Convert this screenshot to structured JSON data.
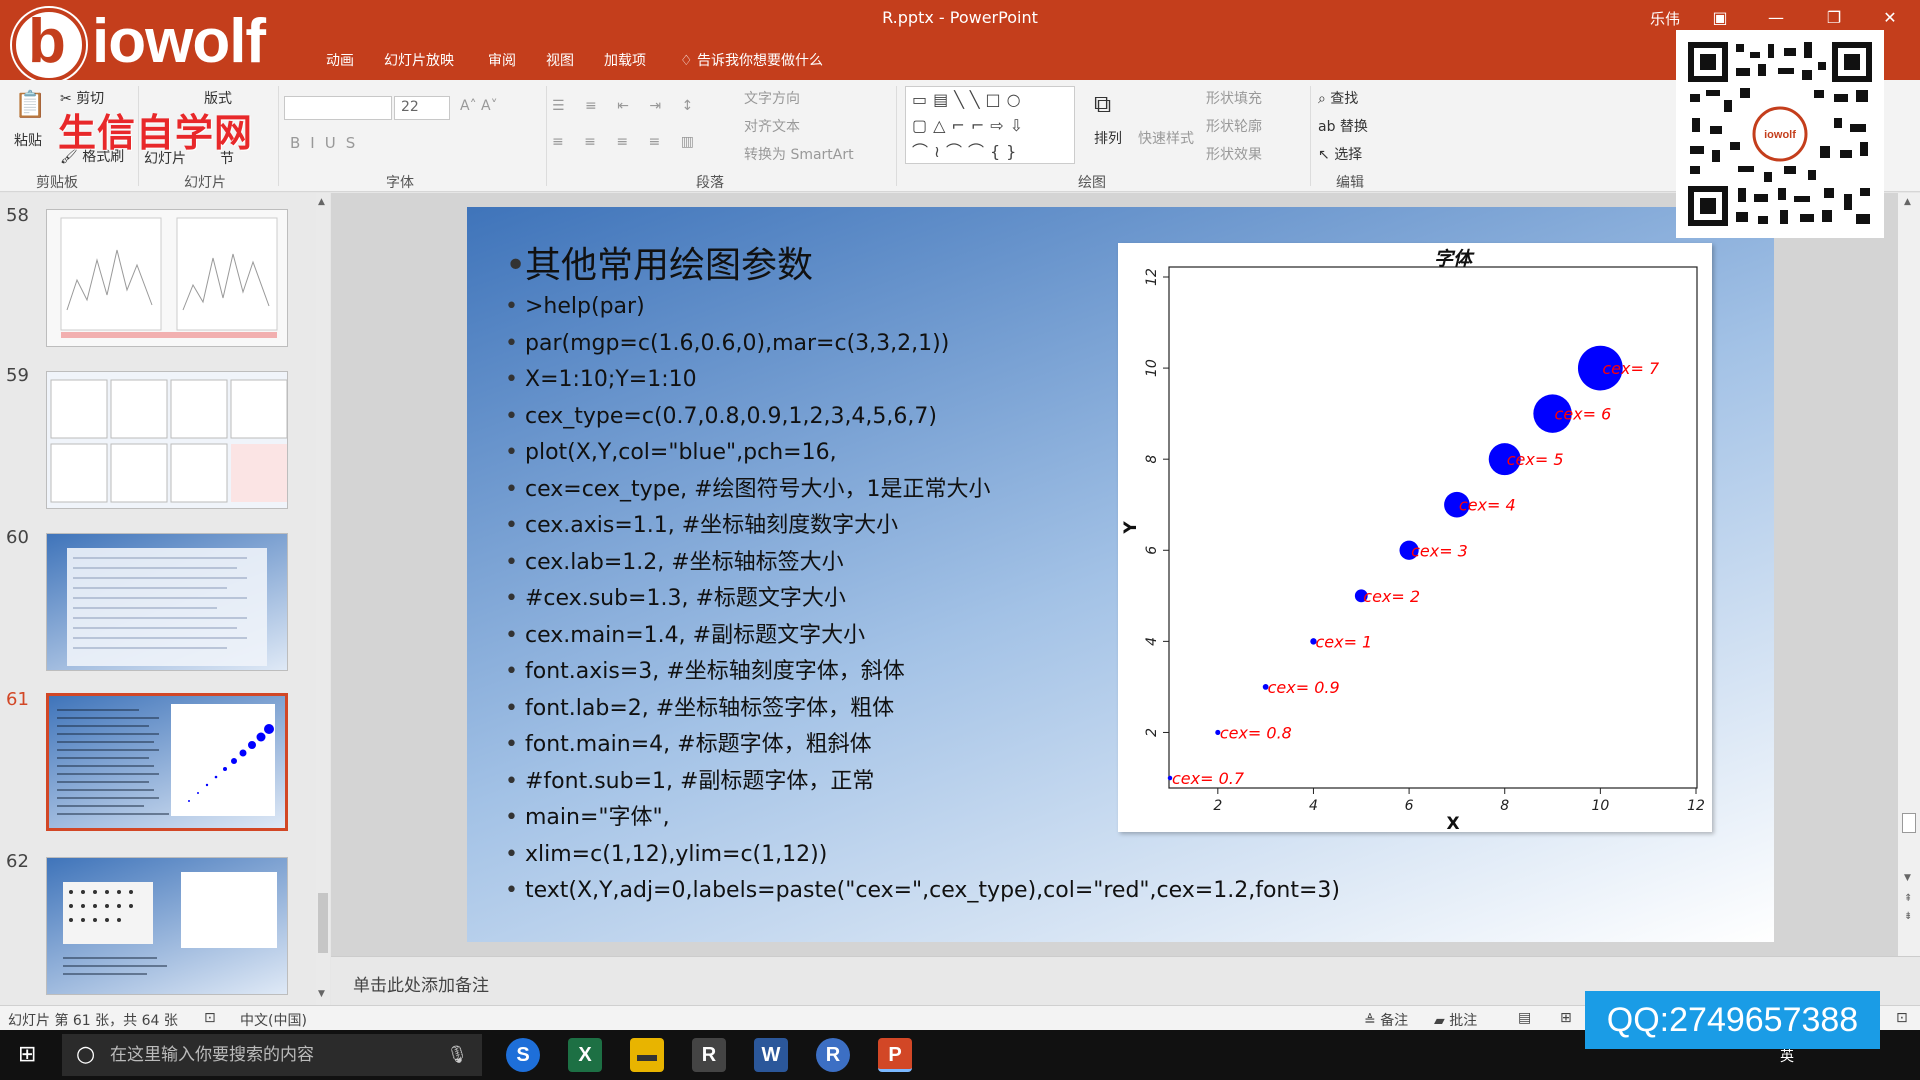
{
  "window": {
    "doc_title": "R.pptx - PowerPoint",
    "user": "乐伟",
    "logo_word": "iowolf",
    "logo_letter": "b"
  },
  "ribbon_tabs": [
    "动画",
    "幻灯片放映",
    "审阅",
    "视图",
    "加载项"
  ],
  "tell_me": "告诉我你想要做什么",
  "ribbon": {
    "site_text": "生信自学网",
    "clipboard": {
      "cut": "剪切",
      "paste": "粘贴",
      "format_painter": "格式刷",
      "group": "剪贴板"
    },
    "slides": {
      "layout": "版式",
      "section": "节",
      "slides_label": "幻灯片",
      "group": "幻灯片"
    },
    "font": {
      "size": "22",
      "group": "字体"
    },
    "paragraph": {
      "text_direction": "文字方向",
      "align_text": "对齐文本",
      "smartart": "转换为 SmartArt",
      "group": "段落"
    },
    "drawing": {
      "arrange": "排列",
      "quick_styles": "快速样式",
      "fill": "形状填充",
      "outline": "形状轮廓",
      "effects": "形状效果",
      "group": "绘图"
    },
    "editing": {
      "find": "查找",
      "replace": "替换",
      "select": "选择",
      "group": "编辑"
    }
  },
  "thumbnails": [
    {
      "num": "58"
    },
    {
      "num": "59"
    },
    {
      "num": "60"
    },
    {
      "num": "61"
    },
    {
      "num": "62"
    }
  ],
  "slide": {
    "heading": "其他常用绘图参数",
    "bullets": [
      ">help(par)",
      "par(mgp=c(1.6,0.6,0),mar=c(3,3,2,1))",
      "X=1:10;Y=1:10",
      "cex_type=c(0.7,0.8,0.9,1,2,3,4,5,6,7)",
      "plot(X,Y,col=\"blue\",pch=16,",
      "cex=cex_type,  #绘图符号大小，1是正常大小",
      "cex.axis=1.1,  #坐标轴刻度数字大小",
      "cex.lab=1.2,  #坐标轴标签大小",
      "#cex.sub=1.3,  #标题文字大小",
      "cex.main=1.4,  #副标题文字大小",
      "font.axis=3,  #坐标轴刻度字体，斜体",
      "font.lab=2,   #坐标轴标签字体，粗体",
      "font.main=4,  #标题字体，粗斜体",
      "#font.sub=1,  #副标题字体，正常",
      "main=\"字体\",",
      "xlim=c(1,12),ylim=c(1,12))",
      "text(X,Y,adj=0,labels=paste(\"cex=\",cex_type),col=\"red\",cex=1.2,font=3)"
    ]
  },
  "chart_data": {
    "type": "scatter",
    "title": "字体",
    "xlabel": "X",
    "ylabel": "Y",
    "xlim": [
      1,
      12
    ],
    "ylim": [
      1,
      12
    ],
    "x_ticks": [
      "2",
      "4",
      "6",
      "8",
      "10",
      "12"
    ],
    "y_ticks": [
      "2",
      "4",
      "6",
      "8",
      "10",
      "12"
    ],
    "x": [
      1,
      2,
      3,
      4,
      5,
      6,
      7,
      8,
      9,
      10
    ],
    "y": [
      1,
      2,
      3,
      4,
      5,
      6,
      7,
      8,
      9,
      10
    ],
    "cex": [
      0.7,
      0.8,
      0.9,
      1,
      2,
      3,
      4,
      5,
      6,
      7
    ],
    "labels": [
      "cex= 0.7",
      "cex= 0.8",
      "cex= 0.9",
      "cex= 1",
      "cex= 2",
      "cex= 3",
      "cex= 4",
      "cex= 5",
      "cex= 6",
      "cex= 7"
    ],
    "point_color": "#0000ff",
    "label_color": "#ff0000",
    "grid": false
  },
  "notes_placeholder": "单击此处添加备注",
  "status": {
    "slide_info": "幻灯片 第 61 张，共 64 张",
    "language": "中文(中国)",
    "notes": "备注",
    "comments": "批注"
  },
  "taskbar": {
    "search_placeholder": "在这里输入你要搜索的内容",
    "time": "英"
  },
  "overlays": {
    "qq": "QQ:2749657388"
  },
  "colors": {
    "accent": "#c43e1c",
    "active_thumb": "#d24726",
    "qq_bg": "#1a9ce6"
  }
}
